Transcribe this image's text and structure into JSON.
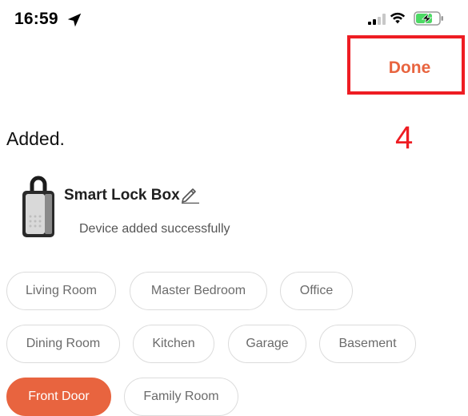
{
  "status_bar": {
    "time": "16:59",
    "location_icon": "location-arrow-icon",
    "signal_icon": "cellular-signal-icon",
    "wifi_icon": "wifi-icon",
    "battery_icon": "battery-charging-icon",
    "battery_color": "#4cd964"
  },
  "header": {
    "done_label": "Done",
    "accent_color": "#e8643f"
  },
  "annotation": {
    "step_number": "4",
    "highlight_color": "#ee1d23"
  },
  "page": {
    "title": "Added."
  },
  "device": {
    "name": "Smart Lock Box",
    "status": "Device added successfully",
    "image_icon": "lock-box-icon",
    "edit_icon": "pencil-icon"
  },
  "rooms": {
    "selected": "Front Door",
    "items": [
      {
        "label": "Living Room"
      },
      {
        "label": "Master Bedroom"
      },
      {
        "label": "Office"
      },
      {
        "label": "Dining Room"
      },
      {
        "label": "Kitchen"
      },
      {
        "label": "Garage"
      },
      {
        "label": "Basement"
      },
      {
        "label": "Front Door"
      },
      {
        "label": "Family Room"
      }
    ]
  }
}
